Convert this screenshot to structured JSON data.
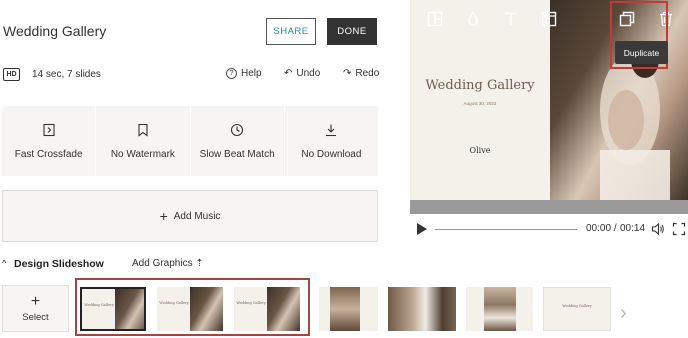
{
  "header": {
    "title": "Wedding Gallery",
    "share_label": "SHARE",
    "done_label": "DONE"
  },
  "meta": {
    "hd_badge": "HD",
    "info": "14 sec, 7 slides",
    "help_label": "Help",
    "undo_label": "Undo",
    "redo_label": "Redo"
  },
  "options": [
    {
      "label": "Fast Crossfade",
      "icon": "transition-icon"
    },
    {
      "label": "No Watermark",
      "icon": "bookmark-icon"
    },
    {
      "label": "Slow Beat Match",
      "icon": "clock-icon"
    },
    {
      "label": "No Download",
      "icon": "download-icon"
    }
  ],
  "music": {
    "add_label": "Add Music"
  },
  "preview": {
    "slide_title": "Wedding Gallery",
    "slide_date": "August 30, 2023",
    "slide_logo": "Olive",
    "tooltip": "Duplicate",
    "time_current": "00:00",
    "time_separator": "/",
    "time_total": "00:14"
  },
  "bottom": {
    "design_label": "Design Slideshow",
    "add_graphics_label": "Add Graphics",
    "select_label": "Select",
    "thumb_text": "Wedding Gallery"
  },
  "colors": {
    "accent_highlight": "#c23a3a",
    "done_bg": "#333333",
    "share_text": "#2a8f9e",
    "panel_bg": "#f6f5f3"
  }
}
